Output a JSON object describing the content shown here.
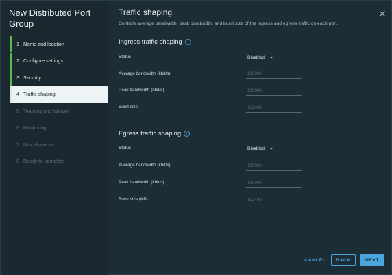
{
  "wizard": {
    "title": "New Distributed Port Group",
    "steps": [
      {
        "num": "1",
        "label": "Name and location",
        "state": "done"
      },
      {
        "num": "2",
        "label": "Configure settings",
        "state": "done"
      },
      {
        "num": "3",
        "label": "Security",
        "state": "done"
      },
      {
        "num": "4",
        "label": "Traffic shaping",
        "state": "current"
      },
      {
        "num": "5",
        "label": "Teaming and failover",
        "state": "future"
      },
      {
        "num": "6",
        "label": "Monitoring",
        "state": "future"
      },
      {
        "num": "7",
        "label": "Miscellaneous",
        "state": "future"
      },
      {
        "num": "8",
        "label": "Ready to complete",
        "state": "future"
      }
    ]
  },
  "page": {
    "title": "Traffic shaping",
    "subtitle": "Controls average bandwidth, peak bandwidth, and burst size of the ingress and egress traffic on each port."
  },
  "ingress": {
    "title": "Ingress traffic shaping",
    "status_label": "Status",
    "status_value": "Disabled",
    "avg_label": "Average bandwidth (kbit/s)",
    "avg_value": "100000",
    "peak_label": "Peak bandwidth (kbit/s)",
    "peak_value": "100000",
    "burst_label": "Burst size",
    "burst_value": "102400"
  },
  "egress": {
    "title": "Egress traffic shaping",
    "status_label": "Status",
    "status_value": "Disabled",
    "avg_label": "Average bandwidth (kbit/s)",
    "avg_value": "100000",
    "peak_label": "Peak bandwidth (kbit/s)",
    "peak_value": "100000",
    "burst_label": "Burst size (KB)",
    "burst_value": "102400"
  },
  "footer": {
    "cancel": "CANCEL",
    "back": "BACK",
    "next": "NEXT"
  },
  "icons": {
    "info": "info-icon",
    "close": "close-icon",
    "dropdown": "chevron-down-icon"
  },
  "colors": {
    "accent": "#49a7dd",
    "done": "#5fb94f"
  }
}
